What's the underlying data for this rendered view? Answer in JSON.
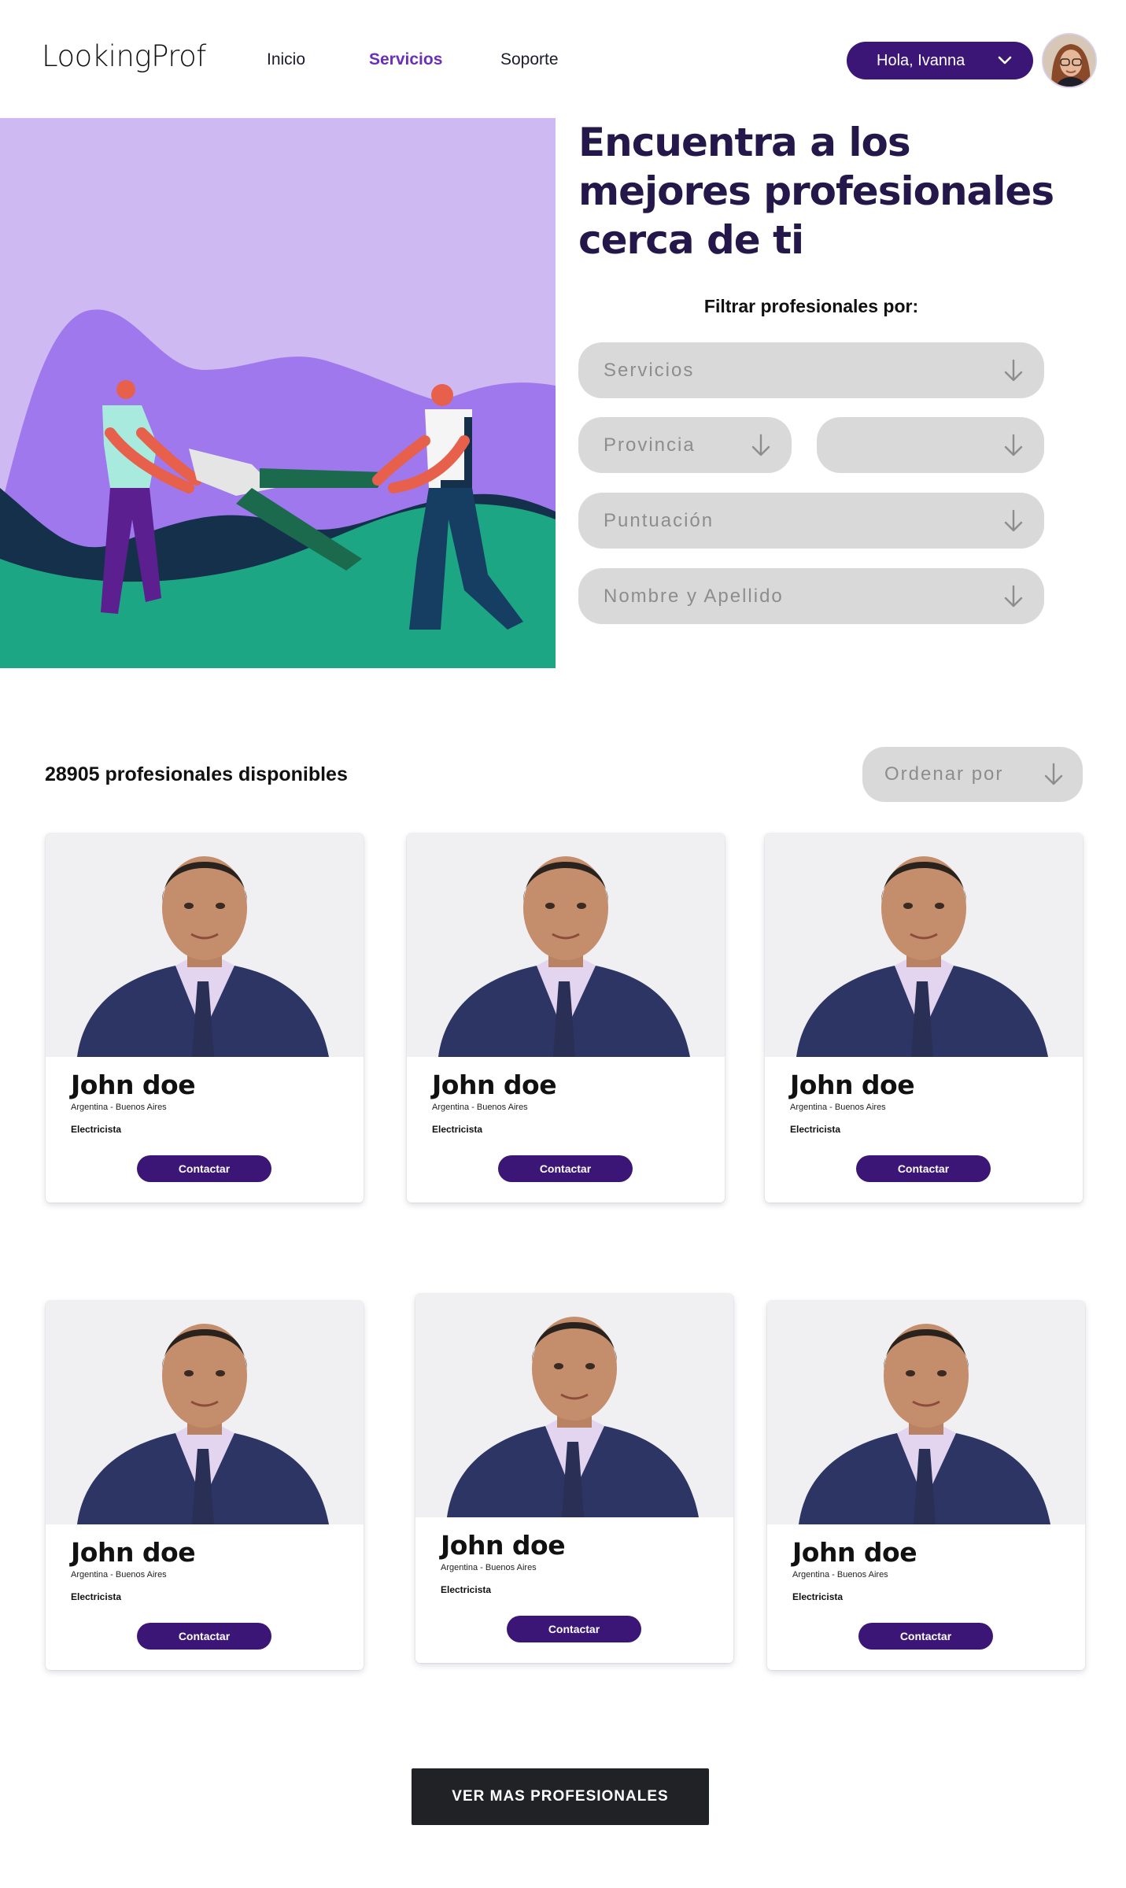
{
  "nav": {
    "logo": "LookingProf",
    "links": [
      "Inicio",
      "Servicios",
      "Soporte"
    ],
    "active": "Servicios",
    "greeting": "Hola, Ivanna"
  },
  "hero": {
    "title_lines": [
      "Encuentra a los",
      "mejores profesionales",
      "cerca de ti"
    ]
  },
  "filters": {
    "label": "Filtrar profesionales por:",
    "servicios": "Servicios",
    "provincia": "Provincia",
    "localidad": "",
    "puntuacion": "Puntuación",
    "nombre": "Nombre y Apellido"
  },
  "results": {
    "count_text": "28905 profesionales disponibles",
    "order_label": "Ordenar por"
  },
  "cards": [
    {
      "name": "John doe",
      "location": "Argentina - Buenos Aires",
      "profession": "Electricista",
      "button": "Contactar"
    },
    {
      "name": "John doe",
      "location": "Argentina - Buenos Aires",
      "profession": "Electricista",
      "button": "Contactar"
    },
    {
      "name": "John doe",
      "location": "Argentina - Buenos Aires",
      "profession": "Electricista",
      "button": "Contactar"
    },
    {
      "name": "John doe",
      "location": "Argentina - Buenos Aires",
      "profession": "Electricista",
      "button": "Contactar"
    },
    {
      "name": "John doe",
      "location": "Argentina - Buenos Aires",
      "profession": "Electricista",
      "button": "Contactar"
    },
    {
      "name": "John doe",
      "location": "Argentina - Buenos Aires",
      "profession": "Electricista",
      "button": "Contactar"
    }
  ],
  "more_button": "VER MAS PROFESIONALES",
  "colors": {
    "brand": "#3b1676",
    "accent_link": "#6a2fb8",
    "title": "#24174a",
    "field_bg": "#d9d9d9"
  }
}
